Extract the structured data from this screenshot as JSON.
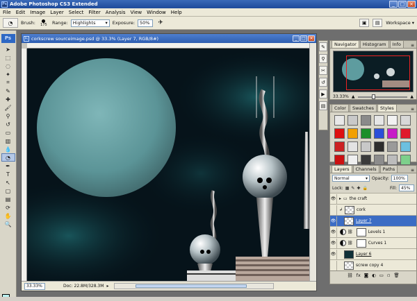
{
  "app": {
    "title": "Adobe Photoshop CS3 Extended",
    "logo": "Ps"
  },
  "menu": [
    "File",
    "Edit",
    "Image",
    "Layer",
    "Select",
    "Filter",
    "Analysis",
    "View",
    "Window",
    "Help"
  ],
  "options": {
    "brush_label": "Brush:",
    "brush_size": "175",
    "range_label": "Range:",
    "range_value": "Highlights",
    "exposure_label": "Exposure:",
    "exposure_value": "50%",
    "workspace_label": "Workspace"
  },
  "document": {
    "title": "corkscrew sourceimage.psd @ 33.3% (Layer 7, RGB/8#)",
    "zoom": "33.33%",
    "doc_info": "Doc: 22.8M/328.3M"
  },
  "colors": {
    "foreground": "#b8f1f0",
    "background": "#000000",
    "planet": "#5e9c9f",
    "sky": "#06131a"
  },
  "navigator": {
    "tabs": [
      "Navigator",
      "Histogram",
      "Info"
    ],
    "zoom": "33.33%"
  },
  "styles_panel": {
    "tabs": [
      "Color",
      "Swatches",
      "Styles"
    ],
    "swatches": [
      "#e8e8e8",
      "#c9c9c9",
      "#8a8a8a",
      "#e6e6e6",
      "#f2f2f2",
      "#d8d8d8",
      "#d11",
      "#f2a000",
      "#1c8f2a",
      "#2b4fd8",
      "#c71cc7",
      "#e01b2b",
      "#cc2222",
      "#e3e3e3",
      "#c8c8c8",
      "#2d2d2d",
      "#9a9a9a",
      "#6cc0e0",
      "#cc1111",
      "#efefef",
      "#3a3a3a",
      "#8c8c8c",
      "#bcbcbc",
      "#7dd08b"
    ]
  },
  "layers_panel": {
    "tabs": [
      "Layers",
      "Channels",
      "Paths"
    ],
    "blend_mode": "Normal",
    "opacity_label": "Opacity:",
    "opacity_value": "100%",
    "lock_label": "Lock:",
    "fill_label": "Fill:",
    "fill_value": "45%",
    "layers": [
      {
        "name": "the craft",
        "type": "group"
      },
      {
        "name": "cork",
        "type": "pixel"
      },
      {
        "name": "Layer 7",
        "type": "pixel",
        "selected": true
      },
      {
        "name": "Levels 1",
        "type": "adjustment"
      },
      {
        "name": "Curves 1",
        "type": "adjustment"
      },
      {
        "name": "Layer 6",
        "type": "pixel"
      },
      {
        "name": "screw copy 4",
        "type": "pixel"
      }
    ]
  }
}
